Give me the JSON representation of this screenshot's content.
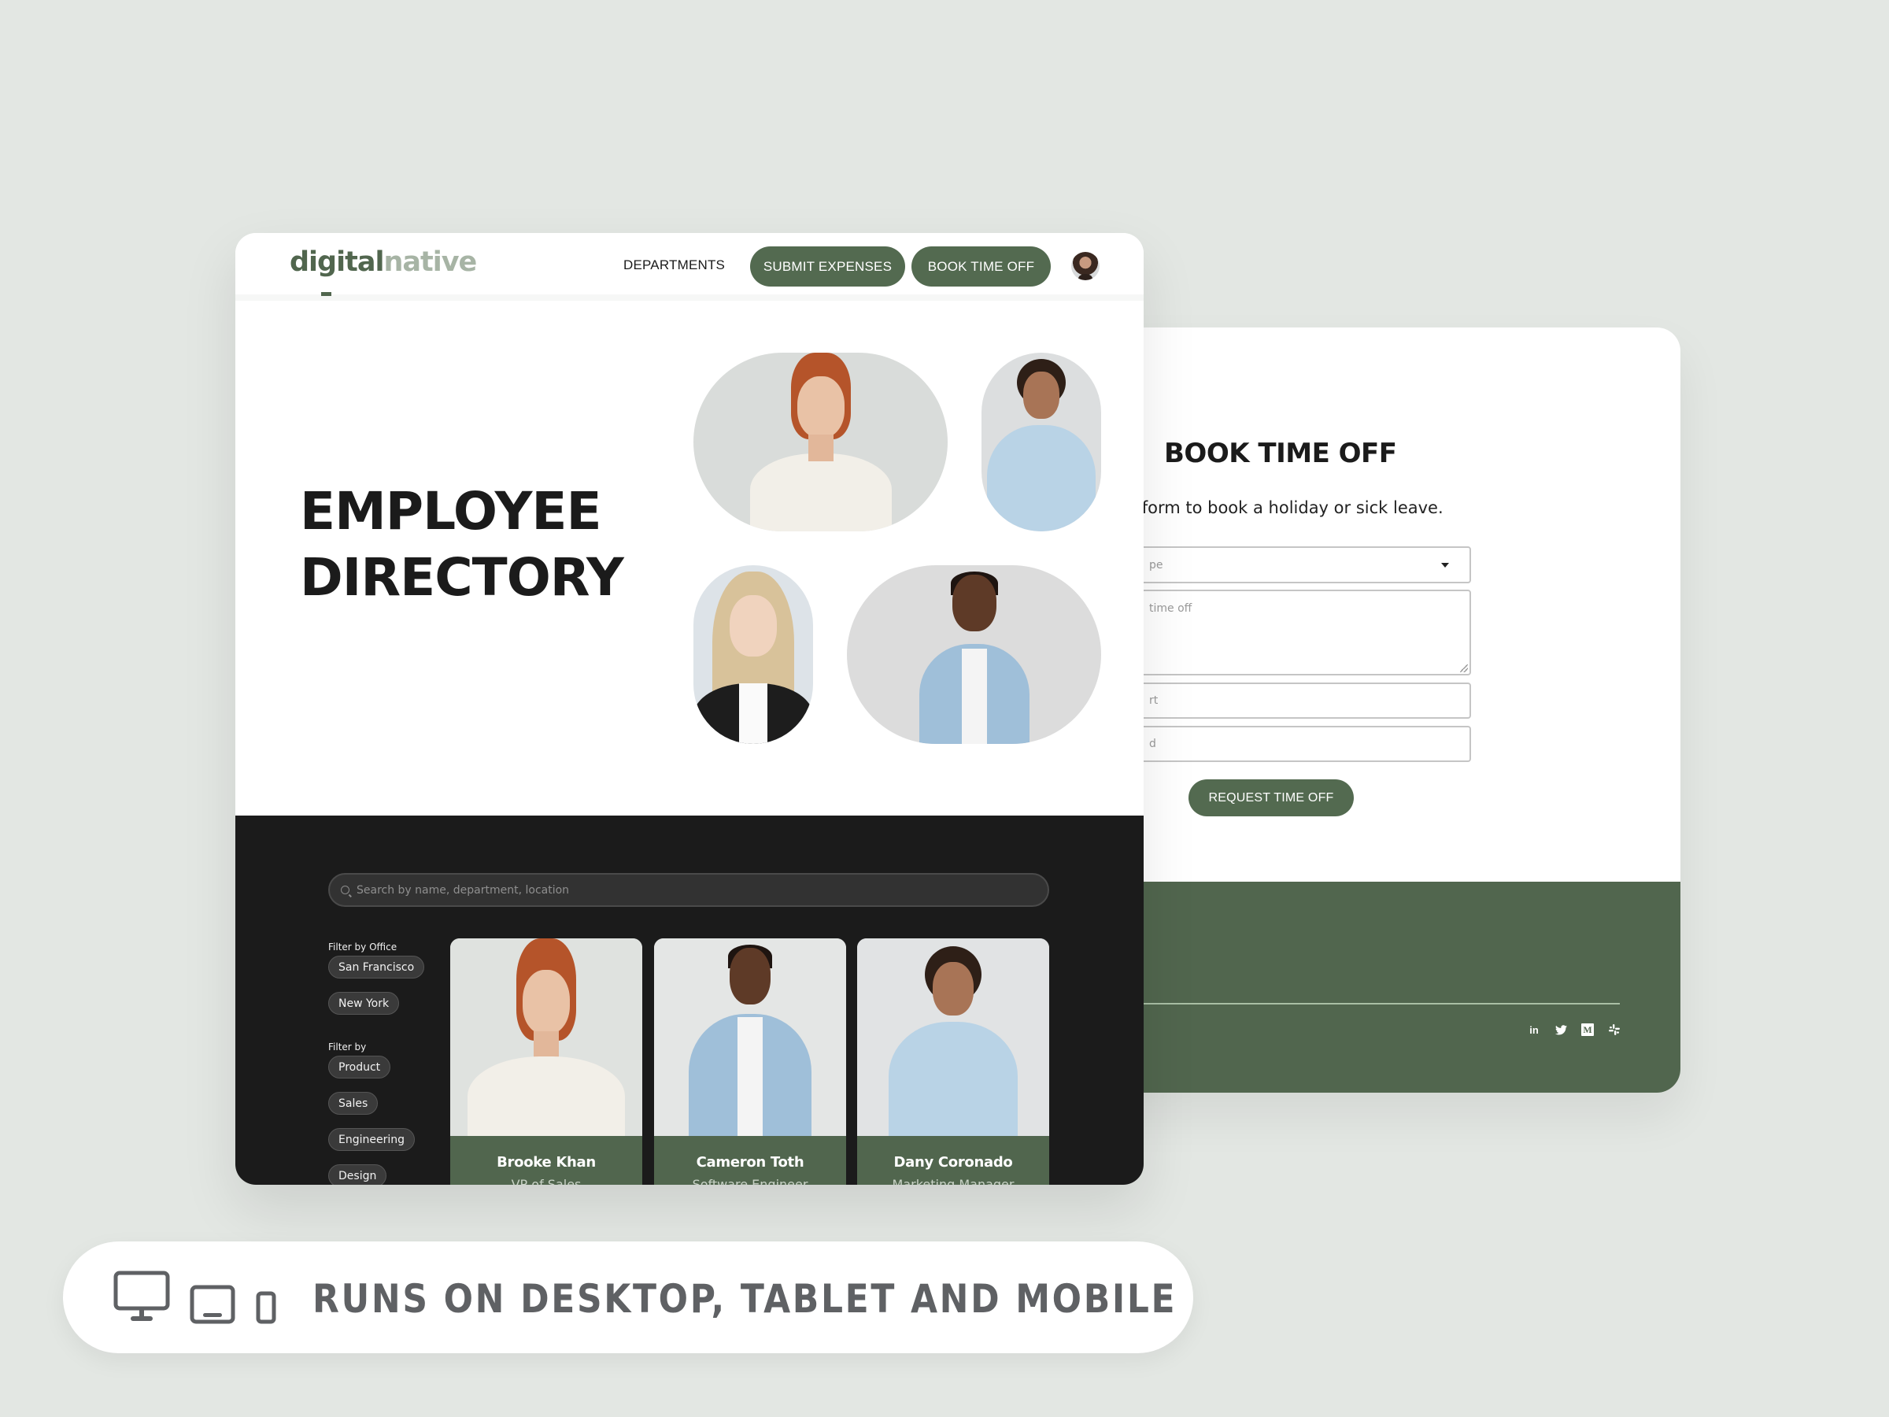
{
  "colors": {
    "brand_green": "#536a50",
    "footer_green": "#51664e",
    "dark_section": "#1b1b1b",
    "background": "#e3e7e3",
    "text_dark": "#1b1b1b",
    "tagline_gray": "#5f6164"
  },
  "main_window": {
    "logo": {
      "part1": "digital",
      "part2": "native"
    },
    "nav": {
      "departments": "DEPARTMENTS",
      "submit_expenses": "SUBMIT EXPENSES",
      "book_time_off": "BOOK TIME OFF",
      "avatar": "user-avatar-icon"
    },
    "hero": {
      "title_line1": "EMPLOYEE",
      "title_line2": "DIRECTORY",
      "portraits": [
        "redhead-woman-portrait",
        "curly-hair-man-portrait",
        "blonde-woman-portrait",
        "glasses-man-portrait"
      ]
    },
    "directory": {
      "search_placeholder": "Search by name, department, location",
      "filter_office_label": "Filter by Office",
      "offices": [
        "San Francisco",
        "New York"
      ],
      "filter_department_label": "Filter by",
      "departments": [
        "Product",
        "Sales",
        "Engineering",
        "Design"
      ],
      "employees": [
        {
          "name": "Brooke Khan",
          "role": "VP of Sales"
        },
        {
          "name": "Cameron Toth",
          "role": "Software Engineer"
        },
        {
          "name": "Dany Coronado",
          "role": "Marketing Manager"
        }
      ]
    }
  },
  "side_panel": {
    "title": "BOOK TIME OFF",
    "subtitle": "Use the form to book a holiday or sick leave.",
    "subtitle_visible": "e the form to book a holiday or sick leave.",
    "fields": {
      "type_visible": "pe",
      "reason_visible": "time off",
      "start_visible": "rt",
      "end_visible": "d"
    },
    "submit_label": "REQUEST TIME OFF",
    "socials": [
      "linkedin-icon",
      "twitter-icon",
      "medium-icon",
      "slack-icon"
    ],
    "social_glyphs": {
      "linkedin": "in",
      "medium": "M"
    }
  },
  "tagline": {
    "text": "RUNS ON DESKTOP, TABLET AND MOBILE",
    "icons": [
      "desktop-icon",
      "tablet-icon",
      "mobile-icon"
    ]
  }
}
